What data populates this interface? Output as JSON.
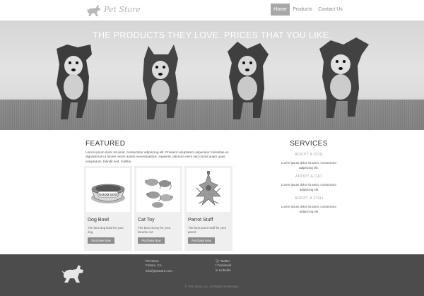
{
  "header": {
    "logo_text": "Pet Store",
    "nav": [
      {
        "label": "Home",
        "active": true
      },
      {
        "label": "Products",
        "active": false
      },
      {
        "label": "Contact Us",
        "active": false
      }
    ]
  },
  "hero": {
    "title": "THE PRODUCTS THEY LOVE. PRICES THAT YOU LIKE."
  },
  "featured": {
    "title": "FEATURED",
    "intro": "Lorem ipsum dolor sit amet, consectetur adipiscing elit. Proident voluptatem asperiatur molestiae ex dignissimos ut facere rerum autem necessitatibus, sapiente, laborum enim sed omnis quam quas voluptatum, blandit sed, mollitia",
    "products": [
      {
        "name": "Dog Bowl",
        "description": "The best dog bowl for your dog",
        "button": "Purchase Now",
        "image_label": "GOOD DOG"
      },
      {
        "name": "Cat Toy",
        "description": "The best cat toy for your favorite cat",
        "button": "Purchase Now"
      },
      {
        "name": "Parrot Stuff",
        "description": "The best parrot stuff for your parrot",
        "button": "Purchase Now"
      }
    ]
  },
  "services": {
    "title": "SERVICES",
    "items": [
      {
        "heading": "ADOPT A DOG",
        "text": "Lorem ipsum dolor sit amet, consectetur adipiscing elit."
      },
      {
        "heading": "ADOPT A CAT",
        "text": "Lorem ipsum dolor sit amet, consectetur adipiscing elit"
      },
      {
        "heading": "ADOPT A FISH",
        "text": "Lorem ipsum dolor sit amet, consectetur adipiscing elit"
      }
    ]
  },
  "footer": {
    "address_line1": "Pet Store",
    "address_line2": "Fresno, CA",
    "email": "info@petstore.com",
    "social": [
      {
        "icon": "twitter-icon",
        "label": "Twitter"
      },
      {
        "icon": "facebook-icon",
        "label": "Facebook"
      },
      {
        "icon": "linkedin-icon",
        "label": "LinkedIn"
      }
    ],
    "copyright": "© Pet Store, Inc. All Rights Reserved."
  }
}
